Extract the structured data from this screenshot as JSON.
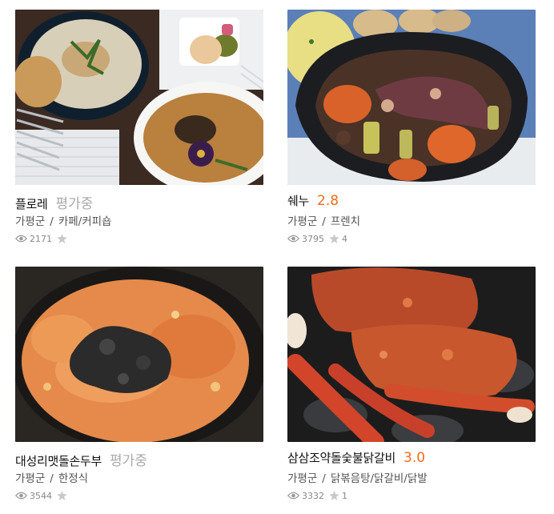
{
  "restaurants": [
    {
      "name": "플로레",
      "rating": "평가중",
      "location": "가평군",
      "category": "카페/커피숍",
      "views": "2171",
      "review_count": ""
    },
    {
      "name": "쉐누",
      "rating": "2.8",
      "location": "가평군",
      "category": "프렌치",
      "views": "3795",
      "review_count": "4"
    },
    {
      "name": "대성리맷돌손두부",
      "rating": "평가중",
      "location": "가평군",
      "category": "한정식",
      "views": "3544",
      "review_count": ""
    },
    {
      "name": "삼삼조약돌숯불닭갈비",
      "rating": "3.0",
      "location": "가평군",
      "category": "닭볶음탕/닭갈비/닭발",
      "views": "3332",
      "review_count": "1"
    }
  ],
  "separator": "/",
  "colors": {
    "rating_scored": "#f26c1a",
    "rating_pending": "#a9a9a9",
    "meta_text": "#555555",
    "stats_text": "#888888"
  },
  "icons": {
    "views": "eye-icon",
    "reviews": "star-icon"
  }
}
